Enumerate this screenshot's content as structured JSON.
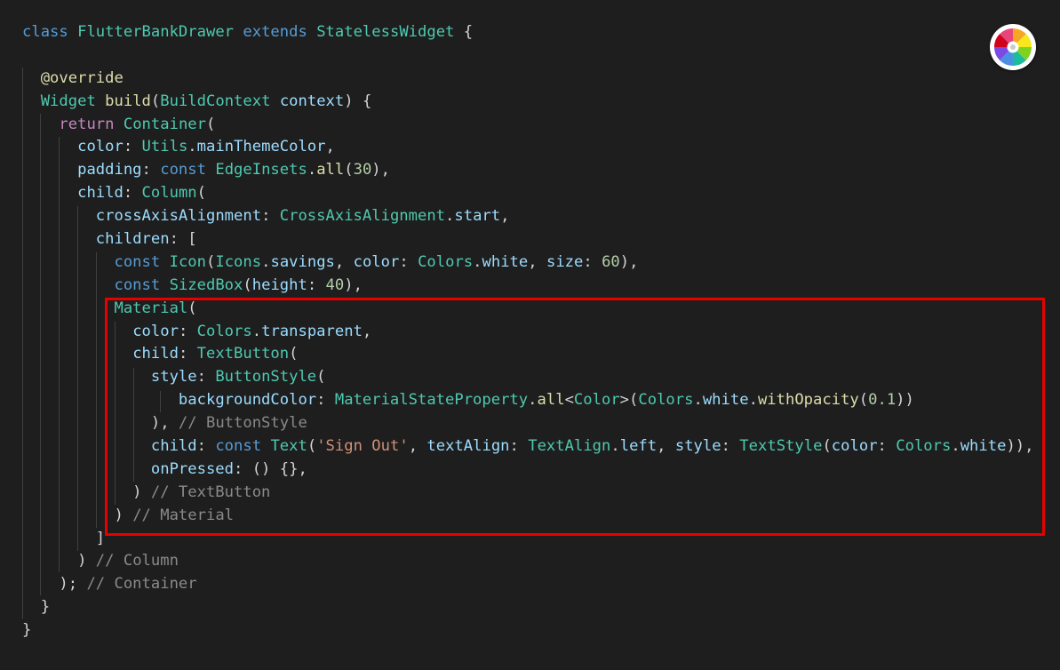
{
  "editor": {
    "language": "dart",
    "lines": [
      [
        [
          "kw",
          "class"
        ],
        [
          "pun",
          " "
        ],
        [
          "cls",
          "FlutterBankDrawer"
        ],
        [
          "pun",
          " "
        ],
        [
          "kw",
          "extends"
        ],
        [
          "pun",
          " "
        ],
        [
          "cls",
          "StatelessWidget"
        ],
        [
          "pun",
          " {"
        ]
      ],
      [],
      [
        [
          "pun",
          "  "
        ],
        [
          "ann",
          "@override"
        ]
      ],
      [
        [
          "pun",
          "  "
        ],
        [
          "cls",
          "Widget"
        ],
        [
          "pun",
          " "
        ],
        [
          "fn",
          "build"
        ],
        [
          "pun",
          "("
        ],
        [
          "cls",
          "BuildContext"
        ],
        [
          "pun",
          " "
        ],
        [
          "var",
          "context"
        ],
        [
          "pun",
          ") {"
        ]
      ],
      [
        [
          "pun",
          "    "
        ],
        [
          "ctl",
          "return"
        ],
        [
          "pun",
          " "
        ],
        [
          "cls",
          "Container"
        ],
        [
          "pun",
          "("
        ]
      ],
      [
        [
          "pun",
          "      "
        ],
        [
          "var",
          "color"
        ],
        [
          "pun",
          ": "
        ],
        [
          "cls",
          "Utils"
        ],
        [
          "pun",
          "."
        ],
        [
          "var",
          "mainThemeColor"
        ],
        [
          "pun",
          ","
        ]
      ],
      [
        [
          "pun",
          "      "
        ],
        [
          "var",
          "padding"
        ],
        [
          "pun",
          ": "
        ],
        [
          "kw",
          "const"
        ],
        [
          "pun",
          " "
        ],
        [
          "cls",
          "EdgeInsets"
        ],
        [
          "pun",
          "."
        ],
        [
          "fn",
          "all"
        ],
        [
          "pun",
          "("
        ],
        [
          "num",
          "30"
        ],
        [
          "pun",
          "),"
        ]
      ],
      [
        [
          "pun",
          "      "
        ],
        [
          "var",
          "child"
        ],
        [
          "pun",
          ": "
        ],
        [
          "cls",
          "Column"
        ],
        [
          "pun",
          "("
        ]
      ],
      [
        [
          "pun",
          "        "
        ],
        [
          "var",
          "crossAxisAlignment"
        ],
        [
          "pun",
          ": "
        ],
        [
          "cls",
          "CrossAxisAlignment"
        ],
        [
          "pun",
          "."
        ],
        [
          "var",
          "start"
        ],
        [
          "pun",
          ","
        ]
      ],
      [
        [
          "pun",
          "        "
        ],
        [
          "var",
          "children"
        ],
        [
          "pun",
          ": ["
        ]
      ],
      [
        [
          "pun",
          "          "
        ],
        [
          "kw",
          "const"
        ],
        [
          "pun",
          " "
        ],
        [
          "cls",
          "Icon"
        ],
        [
          "pun",
          "("
        ],
        [
          "cls",
          "Icons"
        ],
        [
          "pun",
          "."
        ],
        [
          "var",
          "savings"
        ],
        [
          "pun",
          ", "
        ],
        [
          "var",
          "color"
        ],
        [
          "pun",
          ": "
        ],
        [
          "cls",
          "Colors"
        ],
        [
          "pun",
          "."
        ],
        [
          "var",
          "white"
        ],
        [
          "pun",
          ", "
        ],
        [
          "var",
          "size"
        ],
        [
          "pun",
          ": "
        ],
        [
          "num",
          "60"
        ],
        [
          "pun",
          "),"
        ]
      ],
      [
        [
          "pun",
          "          "
        ],
        [
          "kw",
          "const"
        ],
        [
          "pun",
          " "
        ],
        [
          "cls",
          "SizedBox"
        ],
        [
          "pun",
          "("
        ],
        [
          "var",
          "height"
        ],
        [
          "pun",
          ": "
        ],
        [
          "num",
          "40"
        ],
        [
          "pun",
          "),"
        ]
      ],
      [
        [
          "pun",
          "          "
        ],
        [
          "cls",
          "Material"
        ],
        [
          "pun",
          "("
        ]
      ],
      [
        [
          "pun",
          "            "
        ],
        [
          "var",
          "color"
        ],
        [
          "pun",
          ": "
        ],
        [
          "cls",
          "Colors"
        ],
        [
          "pun",
          "."
        ],
        [
          "var",
          "transparent"
        ],
        [
          "pun",
          ","
        ]
      ],
      [
        [
          "pun",
          "            "
        ],
        [
          "var",
          "child"
        ],
        [
          "pun",
          ": "
        ],
        [
          "cls",
          "TextButton"
        ],
        [
          "pun",
          "("
        ]
      ],
      [
        [
          "pun",
          "              "
        ],
        [
          "var",
          "style"
        ],
        [
          "pun",
          ": "
        ],
        [
          "cls",
          "ButtonStyle"
        ],
        [
          "pun",
          "("
        ]
      ],
      [
        [
          "pun",
          "                 "
        ],
        [
          "var",
          "backgroundColor"
        ],
        [
          "pun",
          ": "
        ],
        [
          "cls",
          "MaterialStateProperty"
        ],
        [
          "pun",
          "."
        ],
        [
          "fn",
          "all"
        ],
        [
          "pun",
          "<"
        ],
        [
          "cls",
          "Color"
        ],
        [
          "pun",
          ">("
        ],
        [
          "cls",
          "Colors"
        ],
        [
          "pun",
          "."
        ],
        [
          "var",
          "white"
        ],
        [
          "pun",
          "."
        ],
        [
          "fn",
          "withOpacity"
        ],
        [
          "pun",
          "("
        ],
        [
          "num",
          "0.1"
        ],
        [
          "pun",
          "))"
        ]
      ],
      [
        [
          "pun",
          "              ), "
        ],
        [
          "cmt",
          "// ButtonStyle"
        ]
      ],
      [
        [
          "pun",
          "              "
        ],
        [
          "var",
          "child"
        ],
        [
          "pun",
          ": "
        ],
        [
          "kw",
          "const"
        ],
        [
          "pun",
          " "
        ],
        [
          "cls",
          "Text"
        ],
        [
          "pun",
          "("
        ],
        [
          "str",
          "'Sign Out'"
        ],
        [
          "pun",
          ", "
        ],
        [
          "var",
          "textAlign"
        ],
        [
          "pun",
          ": "
        ],
        [
          "cls",
          "TextAlign"
        ],
        [
          "pun",
          "."
        ],
        [
          "var",
          "left"
        ],
        [
          "pun",
          ", "
        ],
        [
          "var",
          "style"
        ],
        [
          "pun",
          ": "
        ],
        [
          "cls",
          "TextStyle"
        ],
        [
          "pun",
          "("
        ],
        [
          "var",
          "color"
        ],
        [
          "pun",
          ": "
        ],
        [
          "cls",
          "Colors"
        ],
        [
          "pun",
          "."
        ],
        [
          "var",
          "white"
        ],
        [
          "pun",
          ")),"
        ]
      ],
      [
        [
          "pun",
          "              "
        ],
        [
          "var",
          "onPressed"
        ],
        [
          "pun",
          ": () {},"
        ]
      ],
      [
        [
          "pun",
          "            ) "
        ],
        [
          "cmt",
          "// TextButton"
        ]
      ],
      [
        [
          "pun",
          "          ) "
        ],
        [
          "cmt",
          "// Material"
        ]
      ],
      [
        [
          "pun",
          "        ]"
        ]
      ],
      [
        [
          "pun",
          "      ) "
        ],
        [
          "cmt",
          "// Column"
        ]
      ],
      [
        [
          "pun",
          "    ); "
        ],
        [
          "cmt",
          "// Container"
        ]
      ],
      [
        [
          "pun",
          "  }"
        ]
      ],
      [
        [
          "pun",
          "}"
        ]
      ]
    ]
  },
  "colors": {
    "background": "#1e1e1e",
    "highlight_border": "#e60000",
    "indent_guide": "#404040"
  },
  "icons": {
    "color_picker": "color-wheel-icon"
  }
}
